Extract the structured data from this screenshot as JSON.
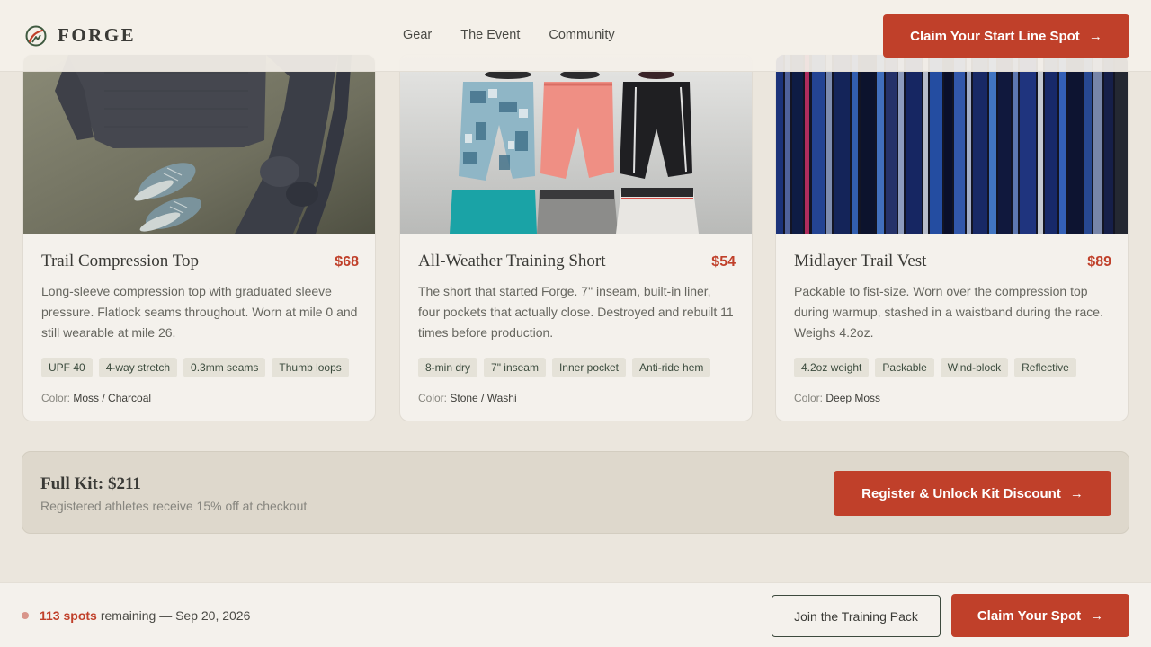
{
  "nav": {
    "brand": "FORGE",
    "links": [
      "Gear",
      "The Event",
      "Community"
    ],
    "cta_label": "Claim Your Start Line Spot",
    "cta_icon": "arrow-right-icon"
  },
  "products": [
    {
      "title": "Trail Compression Top",
      "price": "$68",
      "description": "Long-sleeve compression top with graduated sleeve pressure. Flatlock seams throughout. Worn at mile 0 and still wearable at mile 26.",
      "tags": [
        "UPF 40",
        "4-way stretch",
        "0.3mm seams",
        "Thumb loops"
      ],
      "color_label": "Color:",
      "color_value": "Moss / Charcoal"
    },
    {
      "title": "All-Weather Training Short",
      "price": "$54",
      "description": "The short that started Forge. 7\" inseam, built-in liner, four pockets that actually close. Destroyed and rebuilt 11 times before production.",
      "tags": [
        "8-min dry",
        "7\" inseam",
        "Inner pocket",
        "Anti-ride hem"
      ],
      "color_label": "Color:",
      "color_value": "Stone / Washi"
    },
    {
      "title": "Midlayer Trail Vest",
      "price": "$89",
      "description": "Packable to fist-size. Worn over the compression top during warmup, stashed in a waistband during the race. Weighs 4.2oz.",
      "tags": [
        "4.2oz weight",
        "Packable",
        "Wind-block",
        "Reflective"
      ],
      "color_label": "Color:",
      "color_value": "Deep Moss"
    }
  ],
  "kit": {
    "title": "Full Kit: $211",
    "subtitle": "Registered athletes receive 15% off at checkout",
    "cta_label": "Register & Unlock Kit Discount"
  },
  "bottom_bar": {
    "spots": "113 spots",
    "rest": "remaining — Sep 20, 2026",
    "secondary_label": "Join the Training Pack",
    "primary_label": "Claim Your Spot"
  },
  "colors": {
    "accent": "#c0402a",
    "background": "#ebe6dd",
    "card": "#f4f1ec",
    "tag": "#e5e2d8"
  }
}
